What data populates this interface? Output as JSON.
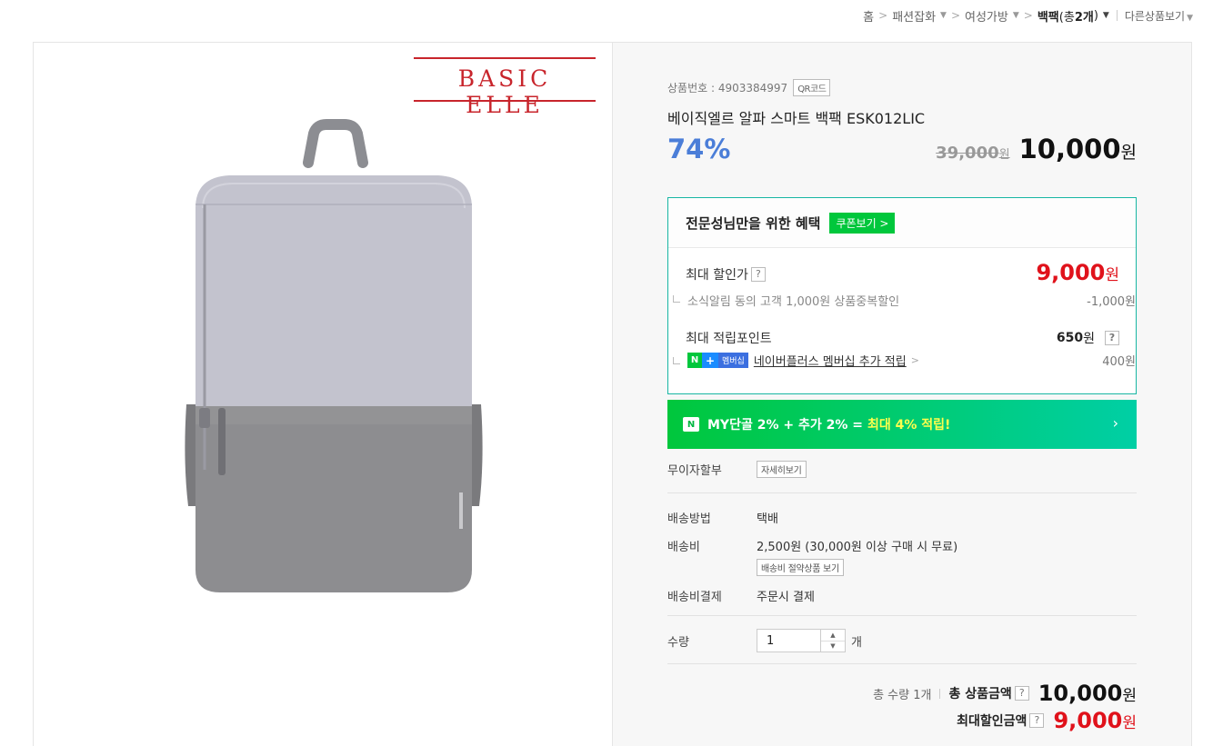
{
  "breadcrumb": {
    "home": "홈",
    "level1": "패션잡화",
    "level2": "여성가방",
    "current_name": "백팩",
    "current_count_prefix": "(총 ",
    "current_count": "2개",
    "current_count_suffix": ")",
    "other_products": "다른상품보기"
  },
  "brand": {
    "logo_text": "BASIC ELLE"
  },
  "product": {
    "number_label": "상품번호 : 4903384997",
    "qr_label": "QR코드",
    "title": "베이직엘르 알파 스마트 백팩 ESK012LIC",
    "discount_rate": "74%",
    "original_price": "39,000",
    "original_won": "원",
    "sale_price": "10,000",
    "sale_won": "원"
  },
  "benefit": {
    "heading": "전문성님만을 위한 혜택",
    "coupon_button": "쿠폰보기 >",
    "max_discount_label": "최대 할인가",
    "max_discount_price": "9,000",
    "max_discount_won": "원",
    "alarm_desc": "소식알림 동의 고객 1,000원 상품중복할인",
    "alarm_amount": "-1,000원",
    "points_label": "최대 적립포인트",
    "points_value": "650",
    "points_won": "원",
    "np_badge_n": "N",
    "np_badge_plus": "+",
    "np_badge_member": "멤버십",
    "np_link": "네이버플러스 멤버십 추가 적립",
    "np_amount": "400원"
  },
  "my_banner": {
    "logo": "N",
    "text": "MY단골 2% + 추가 2% =",
    "highlight": "최대 4% 적립!",
    "arrow": "›"
  },
  "installment": {
    "label": "무이자할부",
    "button": "자세히보기"
  },
  "shipping": {
    "method_label": "배송방법",
    "method_value": "택배",
    "fee_label": "배송비",
    "fee_value": "2,500원 (30,000원 이상 구매 시 무료)",
    "saver_button": "배송비 절약상품 보기",
    "payment_label": "배송비결제",
    "payment_value": "주문시 결제"
  },
  "quantity": {
    "label": "수량",
    "value": "1",
    "unit": "개",
    "up": "▲",
    "down": "▼"
  },
  "totals": {
    "qty_text": "총 수량 1개",
    "total_label": "총 상품금액",
    "total_price": "10,000",
    "total_won": "원",
    "max_label": "최대할인금액",
    "max_price": "9,000",
    "max_won": "원"
  },
  "colors": {
    "accent_blue": "#4b7ed8",
    "price_red": "#e0121b",
    "naver_green": "#00c73c",
    "benefit_border": "#17b6a3"
  },
  "icons": [
    "chevron-down-icon",
    "question-icon",
    "naver-n-icon",
    "chevron-right-icon",
    "arrow-up-icon",
    "arrow-down-icon"
  ]
}
